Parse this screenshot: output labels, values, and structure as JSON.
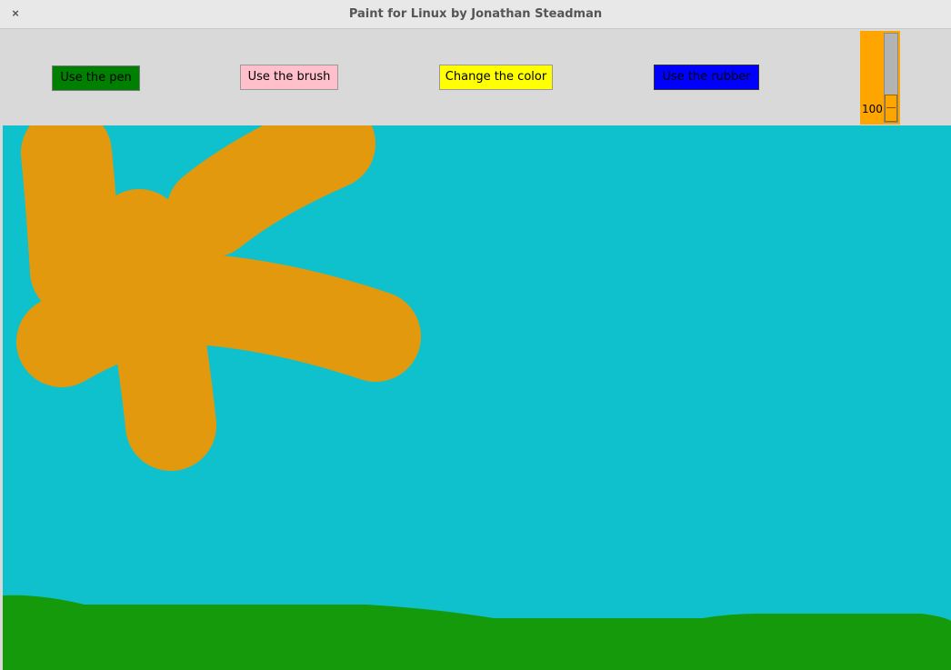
{
  "window": {
    "title": "Paint for Linux by Jonathan Steadman",
    "close_glyph": "×"
  },
  "toolbar": {
    "pen_label": "Use the pen",
    "brush_label": "Use the brush",
    "color_label": "Change the color",
    "rubber_label": "Use the rubber",
    "pen_color": "#008000",
    "brush_color": "#ffc0cb",
    "color_button_color": "#ffff00",
    "rubber_color": "#0000ff"
  },
  "brush_size": {
    "value": "100",
    "color": "#ffa500"
  },
  "canvas": {
    "background": "#0fc1cc",
    "stroke_color": "#e3990d",
    "grass_color": "#159a0c"
  }
}
